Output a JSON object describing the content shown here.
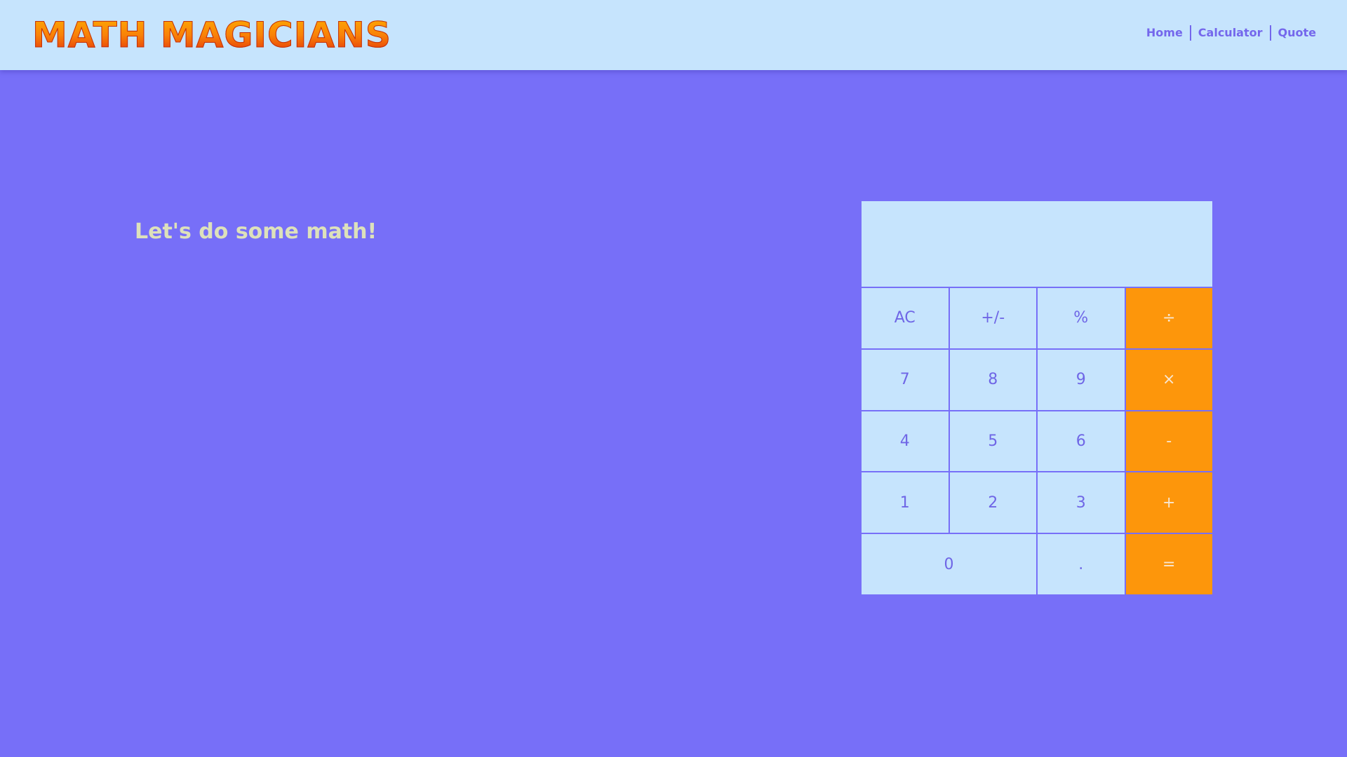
{
  "navbar": {
    "logo": "MATH MAGICIANS",
    "links": [
      "Home",
      "Calculator",
      "Quote"
    ]
  },
  "main": {
    "heading": "Let's do some math!"
  },
  "calculator": {
    "display": "",
    "keys": [
      "AC",
      "+/-",
      "%",
      "÷",
      "7",
      "8",
      "9",
      "×",
      "4",
      "5",
      "6",
      "-",
      "1",
      "2",
      "3",
      "+",
      "0",
      ".",
      "="
    ]
  },
  "colors": {
    "background": "#776ff8",
    "navbar": "#c6e4fd",
    "key": "#c6e4fd",
    "operator_key": "#fd960b",
    "text_accent": "#7467ec",
    "heading_text": "#dde1bb"
  }
}
